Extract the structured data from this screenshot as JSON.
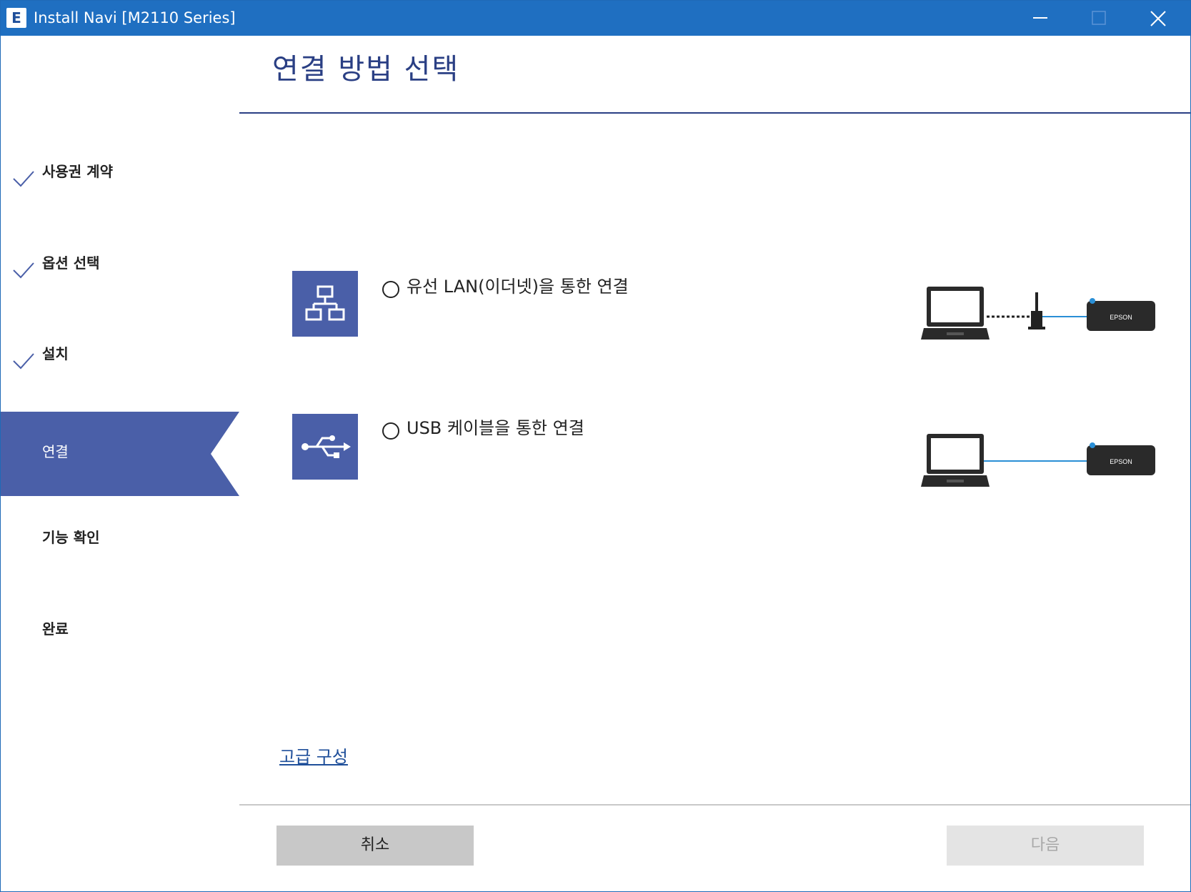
{
  "window": {
    "title": "Install Navi [M2110 Series]",
    "app_icon_letter": "E",
    "controls": {
      "minimize": "minimize-icon",
      "maximize": "maximize-icon",
      "close": "close-icon"
    }
  },
  "sidebar": {
    "steps": [
      {
        "label": "사용권 계약",
        "state": "done"
      },
      {
        "label": "옵션 선택",
        "state": "done"
      },
      {
        "label": "설치",
        "state": "done"
      },
      {
        "label": "연결",
        "state": "current"
      },
      {
        "label": "기능 확인",
        "state": "pending"
      },
      {
        "label": "완료",
        "state": "pending"
      }
    ]
  },
  "main": {
    "title": "연결 방법 선택",
    "options": [
      {
        "label": "유선 LAN(이더넷)을 통한 연결",
        "icon": "network-icon",
        "selected": false,
        "diagram_brand": "EPSON"
      },
      {
        "label": "USB 케이블을 통한 연결",
        "icon": "usb-icon",
        "selected": false,
        "diagram_brand": "EPSON"
      }
    ],
    "advanced_link": "고급 구성"
  },
  "footer": {
    "cancel_label": "취소",
    "next_label": "다음"
  },
  "colors": {
    "titlebar": "#1f6fc1",
    "accent": "#4a5fa8",
    "heading": "#2a3f84",
    "link": "#1f4f9a",
    "cable": "#2a8fd6"
  }
}
